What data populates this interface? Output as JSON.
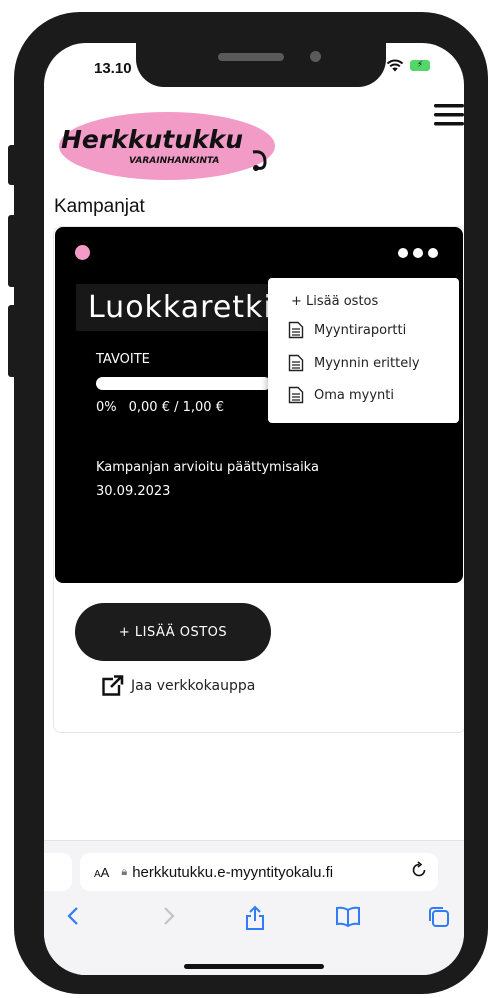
{
  "status_bar": {
    "time": "13.10"
  },
  "brand": {
    "name": "Herkkutukku",
    "tagline": "VARAINHANKINTA",
    "pink": "#f29bc7"
  },
  "page": {
    "title": "Kampanjat"
  },
  "campaign": {
    "title": "Luokkaretki",
    "goal_label": "TAVOITE",
    "progress_fraction": 0,
    "progress_percent": "0%",
    "progress_amounts": "0,00 € / 1,00 €",
    "end_label": "Kampanjan arvioitu päättymisaika",
    "end_date": "30.09.2023"
  },
  "dropdown": {
    "add_label": "+ Lisää ostos",
    "items": [
      {
        "label": "Myyntiraportti",
        "icon": "document-icon"
      },
      {
        "label": "Myynnin erittely",
        "icon": "document-icon"
      },
      {
        "label": "Oma myynti",
        "icon": "document-icon"
      }
    ]
  },
  "actions": {
    "add_purchase": "+ LISÄÄ OSTOS",
    "share_store": "Jaa verkkokauppa"
  },
  "browser": {
    "text_size_label": "AA",
    "url": "herkkutukku.e-myyntityokalu.fi",
    "accent": "#2f7cf6"
  }
}
